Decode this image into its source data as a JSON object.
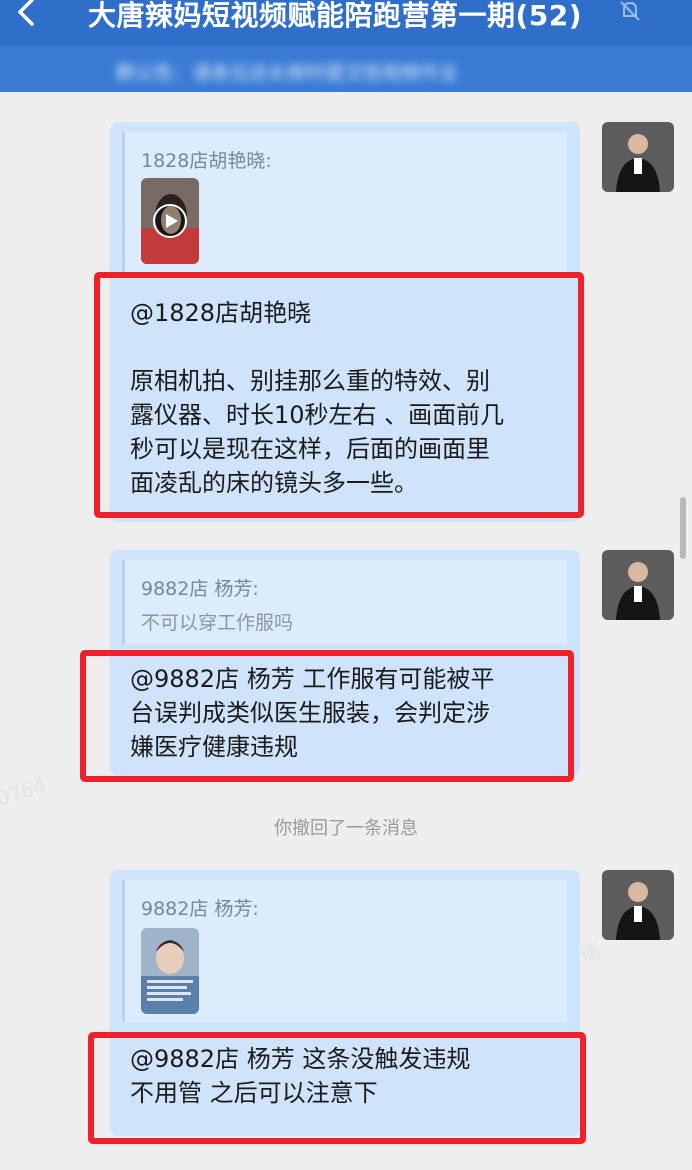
{
  "header": {
    "title": "大唐辣妈短视频赋能陪跑营第一期(52)",
    "notice": "群公告：请各位店长按时提交短视频作业"
  },
  "messages": [
    {
      "quote_name": "1828店胡艳晓:",
      "quote_kind": "video",
      "reply_lines": [
        "@1828店胡艳晓",
        "",
        "原相机拍、别挂那么重的特效、别",
        "露仪器、时长10秒左右 、画面前几",
        "秒可以是现在这样，后面的画面里",
        "面凌乱的床的镜头多一些。"
      ]
    },
    {
      "quote_name": "9882店  杨芳:",
      "quote_text": "不可以穿工作服吗",
      "reply_lines": [
        "@9882店  杨芳 工作服有可能被平",
        "台误判成类似医生服装，会判定涉",
        "嫌医疗健康违规"
      ]
    },
    {
      "quote_name": "9882店  杨芳:",
      "quote_kind": "video",
      "reply_lines": [
        "@9882店  杨芳  这条没触发违规",
        "不用管  之后可以注意下"
      ]
    }
  ],
  "system": {
    "recalled": "你撤回了一条消息"
  },
  "icons": {
    "back": "chevron-left-icon",
    "mute": "bell-off-icon",
    "play": "play-icon",
    "avatar": "user-avatar"
  },
  "colors": {
    "header": "#2f6fc9",
    "bubble": "#cfe4fb",
    "highlight": "#f0212b",
    "background": "#eeeeee"
  }
}
